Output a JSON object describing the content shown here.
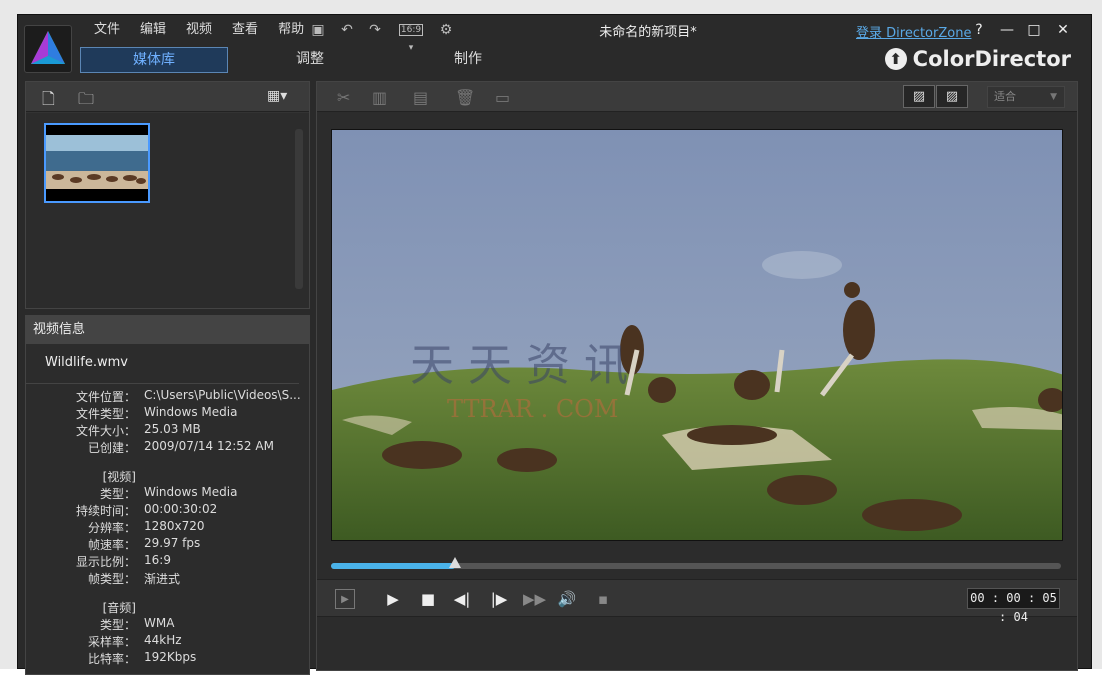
{
  "menu": [
    "文件",
    "编辑",
    "视频",
    "查看",
    "帮助"
  ],
  "toolbar": {
    "aspect_label": "16:9"
  },
  "window": {
    "title": "未命名的新项目*",
    "login_label": "登录 DirectorZone",
    "help": "?",
    "minimize": "—",
    "maximize": "□",
    "close": "✕"
  },
  "tabs": {
    "media": "媒体库",
    "adjust": "调整",
    "produce": "制作"
  },
  "brand": "ColorDirector",
  "library": {},
  "info": {
    "header": "视频信息",
    "filename": "Wildlife.wmv",
    "rows": [
      {
        "label": "文件位置：",
        "value": "C:\\Users\\Public\\Videos\\S..."
      },
      {
        "label": "文件类型：",
        "value": "Windows Media"
      },
      {
        "label": "文件大小：",
        "value": "25.03 MB"
      },
      {
        "label": "已创建：",
        "value": "2009/07/14 12:52 AM"
      },
      {
        "label": "[视频]",
        "value": ""
      },
      {
        "label": "类型：",
        "value": "Windows Media"
      },
      {
        "label": "持续时间：",
        "value": "00:00:30:02"
      },
      {
        "label": "分辨率：",
        "value": "1280x720"
      },
      {
        "label": "帧速率：",
        "value": "29.97 fps"
      },
      {
        "label": "显示比例：",
        "value": "16:9"
      },
      {
        "label": "帧类型：",
        "value": "渐进式"
      },
      {
        "label": "[音频]",
        "value": ""
      },
      {
        "label": "类型：",
        "value": "WMA"
      },
      {
        "label": "采样率：",
        "value": "44kHz"
      },
      {
        "label": "比特率：",
        "value": "192Kbps"
      }
    ]
  },
  "preview": {
    "fit_label": "适合",
    "timecode": "00 : 00 : 05 : 04",
    "seek_progress": 0.17,
    "watermark": "天 天 资 讯",
    "watermark_sub": "TTRAR . COM"
  },
  "colors": {
    "accent": "#4ab3ea",
    "panel": "#2c2c2c",
    "tab_active": "#6fb0ff"
  }
}
